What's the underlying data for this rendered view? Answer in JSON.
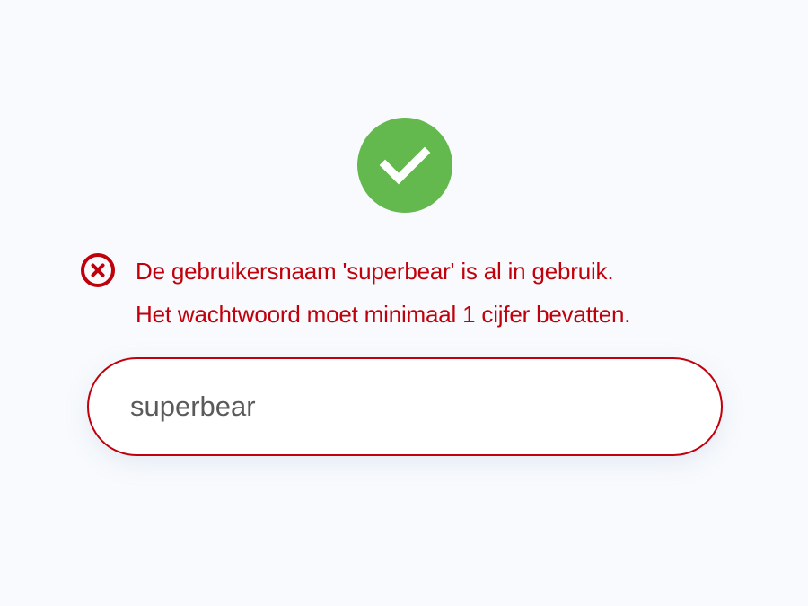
{
  "status": {
    "icon": "check-circle-icon",
    "color": "#63b84e"
  },
  "errors": {
    "icon": "x-circle-icon",
    "color": "#c0000b",
    "messages": [
      "De gebruikersnaam 'superbear' is al in gebruik.",
      "Het wachtwoord moet minimaal 1 cijfer bevatten."
    ]
  },
  "username_field": {
    "value": "superbear",
    "border_color": "#c0000b"
  },
  "colors": {
    "background": "#f8fafd",
    "field_text": "#5a5a5a"
  }
}
